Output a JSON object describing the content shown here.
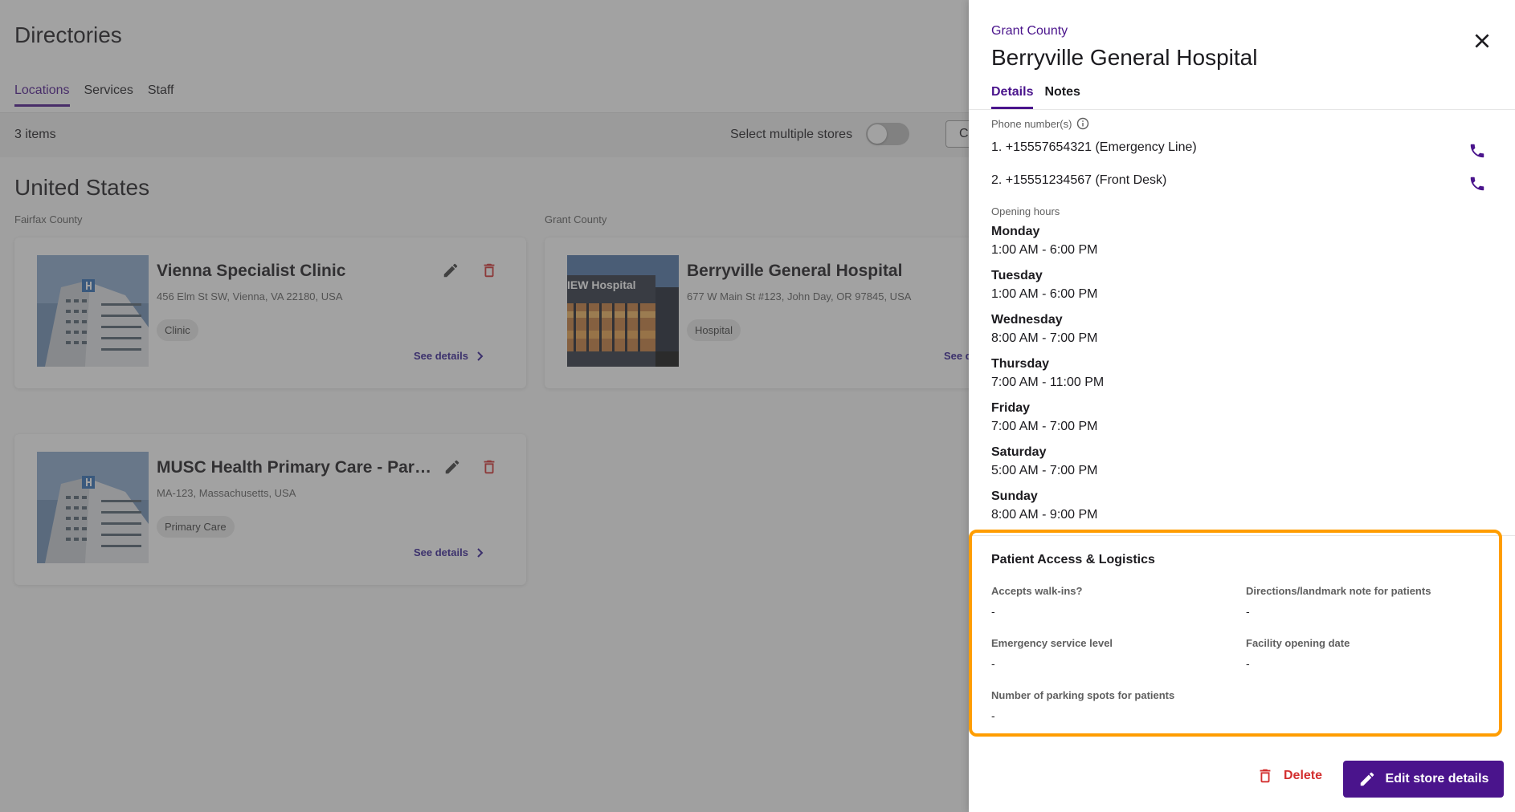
{
  "page": {
    "title": "Directories",
    "tabs": [
      {
        "label": "Locations",
        "active": true
      },
      {
        "label": "Services",
        "active": false
      },
      {
        "label": "Staff",
        "active": false
      }
    ],
    "toolbar": {
      "items_count": "3 items",
      "multi_select_label": "Select multiple stores",
      "multi_select_on": false,
      "partial_button_label": "C"
    },
    "country": "United States",
    "counties": [
      "Fairfax County",
      "Grant County"
    ],
    "cards": [
      {
        "name": "Vienna Specialist Clinic",
        "address": "456 Elm St SW, Vienna, VA 22180, USA",
        "chip": "Clinic",
        "see_details": "See details",
        "image_icon": "hospital-building-image"
      },
      {
        "name": "Berryville General Hospital",
        "address": "677 W Main St #123, John Day, OR 97845, USA",
        "chip": "Hospital",
        "see_details": "See details",
        "image_icon": "hospital-night-image",
        "image_sign_text": "IEW Hospital"
      },
      {
        "name": "MUSC Health Primary Care - Park W…",
        "address": "MA-123, Massachusetts, USA",
        "chip": "Primary Care",
        "see_details": "See details",
        "image_icon": "hospital-building-image"
      }
    ]
  },
  "drawer": {
    "county": "Grant County",
    "title": "Berryville General Hospital",
    "tabs": [
      {
        "label": "Details",
        "active": true
      },
      {
        "label": "Notes",
        "active": false
      }
    ],
    "phone_label": "Phone number(s)",
    "phones": [
      "1.  +15557654321 (Emergency Line)",
      "2.  +15551234567 (Front Desk)"
    ],
    "hours_label": "Opening hours",
    "hours": [
      {
        "day": "Monday",
        "time": "1:00 AM - 6:00 PM"
      },
      {
        "day": "Tuesday",
        "time": "1:00 AM - 6:00 PM"
      },
      {
        "day": "Wednesday",
        "time": "8:00 AM - 7:00 PM"
      },
      {
        "day": "Thursday",
        "time": "7:00 AM - 11:00 PM"
      },
      {
        "day": "Friday",
        "time": "7:00 AM - 7:00 PM"
      },
      {
        "day": "Saturday",
        "time": "5:00 AM - 7:00 PM"
      },
      {
        "day": "Sunday",
        "time": "8:00 AM - 9:00 PM"
      }
    ],
    "patient_access": {
      "title": "Patient Access & Logistics",
      "fields": [
        {
          "label": "Accepts walk-ins?",
          "value": "-"
        },
        {
          "label": "Directions/landmark note for patients",
          "value": "-"
        },
        {
          "label": "Emergency service level",
          "value": "-"
        },
        {
          "label": "Facility opening date",
          "value": "-"
        },
        {
          "label": "Number of parking spots for patients",
          "value": "-"
        }
      ]
    },
    "actions": {
      "delete": "Delete",
      "edit": "Edit store details"
    }
  },
  "colors": {
    "accent": "#4a148c",
    "delete": "#d32f2f",
    "highlight": "#ff9d00",
    "overlay": "rgba(70,70,70,0.5)"
  }
}
